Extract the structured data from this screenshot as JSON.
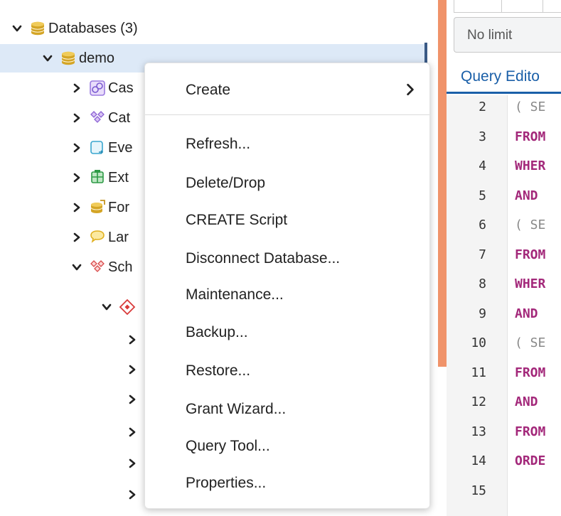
{
  "tree": {
    "databases_label": "Databases (3)",
    "demo_label": "demo",
    "children": [
      {
        "label": "Cas",
        "icon": "cast-icon"
      },
      {
        "label": "Cat",
        "icon": "catalog-icon"
      },
      {
        "label": "Eve",
        "icon": "event-trigger-icon"
      },
      {
        "label": "Ext",
        "icon": "extension-icon"
      },
      {
        "label": "For",
        "icon": "foreign-data-wrapper-icon"
      },
      {
        "label": "Lar",
        "icon": "language-icon"
      },
      {
        "label": "Sch",
        "icon": "schemas-icon"
      }
    ]
  },
  "right_pane": {
    "limit_value": "No limit",
    "tab_label": "Query Edito",
    "code_lines": [
      {
        "num": "2",
        "text": "( SE",
        "type": "paren"
      },
      {
        "num": "3",
        "text": "FROM",
        "type": "kw"
      },
      {
        "num": "4",
        "text": "WHER",
        "type": "kw"
      },
      {
        "num": "5",
        "text": "AND ",
        "type": "kw"
      },
      {
        "num": "6",
        "text": "( SE",
        "type": "paren"
      },
      {
        "num": "7",
        "text": "FROM",
        "type": "kw"
      },
      {
        "num": "8",
        "text": "WHER",
        "type": "kw"
      },
      {
        "num": "9",
        "text": "AND ",
        "type": "kw"
      },
      {
        "num": "10",
        "text": "( SE",
        "type": "paren"
      },
      {
        "num": "11",
        "text": "FROM",
        "type": "kw"
      },
      {
        "num": "12",
        "text": "AND ",
        "type": "kw"
      },
      {
        "num": "13",
        "text": "FROM",
        "type": "kw"
      },
      {
        "num": "14",
        "text": "ORDE",
        "type": "kw"
      },
      {
        "num": "15",
        "text": "",
        "type": "kw"
      }
    ]
  },
  "context_menu": {
    "items": [
      "Create",
      "Refresh...",
      "Delete/Drop",
      "CREATE Script",
      "Disconnect Database...",
      "Maintenance...",
      "Backup...",
      "Restore...",
      "Grant Wizard...",
      "Query Tool...",
      "Properties..."
    ]
  },
  "colors": {
    "selection": "#dde9f7",
    "accent": "#1a5fa8",
    "keyword": "#a3287a",
    "panel_divider": "#f0936a"
  }
}
